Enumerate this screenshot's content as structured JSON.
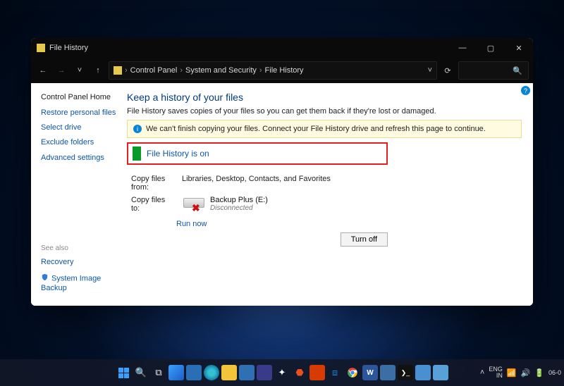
{
  "window": {
    "title": "File History",
    "controls": {
      "minimize": "—",
      "maximize": "▢",
      "close": "✕"
    }
  },
  "nav": {
    "back": "←",
    "forward": "→",
    "recent": "˅",
    "up": "↑",
    "breadcrumb_sep": "›",
    "crumbs": [
      "Control Panel",
      "System and Security",
      "File History"
    ],
    "addr_dropdown": "˅",
    "refresh": "⟳",
    "search_icon": "🔍"
  },
  "sidebar": {
    "home": "Control Panel Home",
    "items": [
      "Restore personal files",
      "Select drive",
      "Exclude folders",
      "Advanced settings"
    ],
    "seealso_heading": "See also",
    "seealso": [
      "Recovery",
      "System Image Backup"
    ]
  },
  "main": {
    "heading": "Keep a history of your files",
    "description": "File History saves copies of your files so you can get them back if they're lost or damaged.",
    "warning": "We can't finish copying your files. Connect your File History drive and refresh this page to continue.",
    "status": "File History is on",
    "copy_from_label": "Copy files from:",
    "copy_from_value": "Libraries, Desktop, Contacts, and Favorites",
    "copy_to_label": "Copy files to:",
    "drive_name": "Backup Plus (E:)",
    "drive_status": "Disconnected",
    "run_now": "Run now",
    "turn_off": "Turn off",
    "help_tooltip": "?"
  },
  "tray": {
    "lang1": "ENG",
    "lang2": "IN",
    "date": "06-0"
  }
}
